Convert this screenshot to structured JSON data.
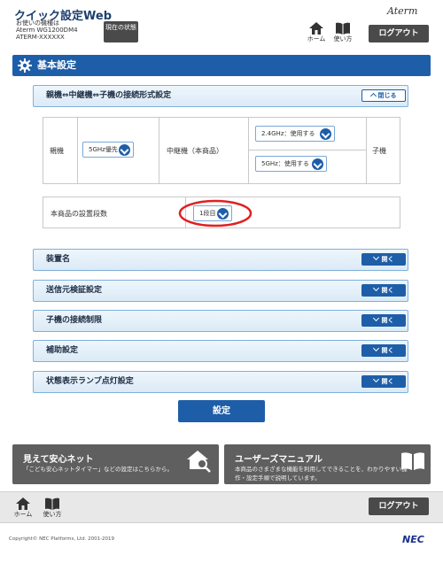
{
  "header": {
    "app_title": "クイック設定Web",
    "device_label": "お使いの機種は",
    "device_model": "Aterm WG1200DM4",
    "device_ssid": "ATERM-XXXXXX",
    "status_button": "現在の状態",
    "home_label": "ホーム",
    "manual_label": "使い方",
    "logout_label": "ログアウト",
    "brand": "Aterm"
  },
  "section": {
    "title": "基本設定"
  },
  "connection_panel": {
    "title": "親機⇔中継機⇔子機の接続形式設定",
    "close_label": "閉じる",
    "parent_label": "親機",
    "parent_value": "5GHz優先",
    "repeater_label": "中継機（本商品）",
    "band24_value": "2.4GHz：使用する",
    "band5_value": "5GHz：使用する",
    "child_label": "子機"
  },
  "stage": {
    "label": "本商品の設置段数",
    "value": "1段目"
  },
  "panels": [
    {
      "title": "装置名",
      "button": "開く"
    },
    {
      "title": "送信元検証設定",
      "button": "開く"
    },
    {
      "title": "子機の接続制限",
      "button": "開く"
    },
    {
      "title": "補助設定",
      "button": "開く"
    },
    {
      "title": "状態表示ランプ点灯設定",
      "button": "開く"
    }
  ],
  "apply_button": "設定",
  "promo_left": {
    "title": "見えて安心ネット",
    "desc": "「こども安心ネットタイマー」などの設定はこちらから。"
  },
  "promo_right": {
    "title": "ユーザーズマニュアル",
    "desc_line1": "本商品のさまざまな機能を利用してできることを、わかりやすい操",
    "desc_line2": "作・設定手順で説明しています。"
  },
  "footer": {
    "home_label": "ホーム",
    "manual_label": "使い方",
    "logout_label": "ログアウト",
    "copyright": "Copyright© NEC Platforms, Ltd. 2001-2019",
    "nec": "NEC"
  },
  "colors": {
    "accent": "#1e5ea8",
    "highlight_ring": "#e02020",
    "dark_button": "#4a4a4a"
  }
}
